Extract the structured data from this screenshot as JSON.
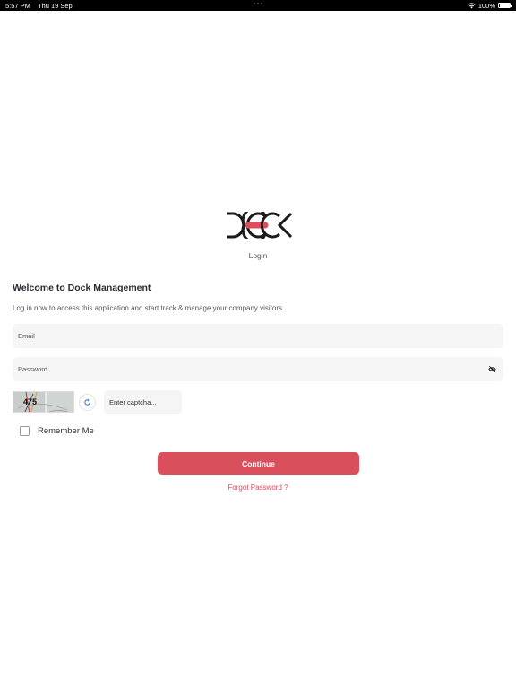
{
  "status_bar": {
    "time": "5:57 PM",
    "date": "Thu 19 Sep",
    "battery": "100%",
    "wifi_icon": "wifi-icon",
    "battery_icon": "battery-icon"
  },
  "logo": {
    "text": "DOCK",
    "accent_color": "#d9505c"
  },
  "login_title": "Login",
  "welcome_title": "Welcome to Dock Management",
  "subtitle": "Log in now to access this application and start track & manage your company visitors.",
  "form": {
    "email_placeholder": "Email",
    "email_value": "",
    "password_placeholder": "Password",
    "password_value": "",
    "password_toggle_icon": "eye-off-icon",
    "captcha_text": "475",
    "captcha_refresh_icon": "refresh-icon",
    "captcha_placeholder": "Enter captcha...",
    "captcha_value": "",
    "remember_label": "Remember Me",
    "remember_checked": false,
    "continue_label": "Continue",
    "forgot_label": "Forgot Password ?"
  },
  "colors": {
    "accent": "#d9505c",
    "field_bg": "#f5f5f5",
    "text_dark": "#2a2a33"
  }
}
